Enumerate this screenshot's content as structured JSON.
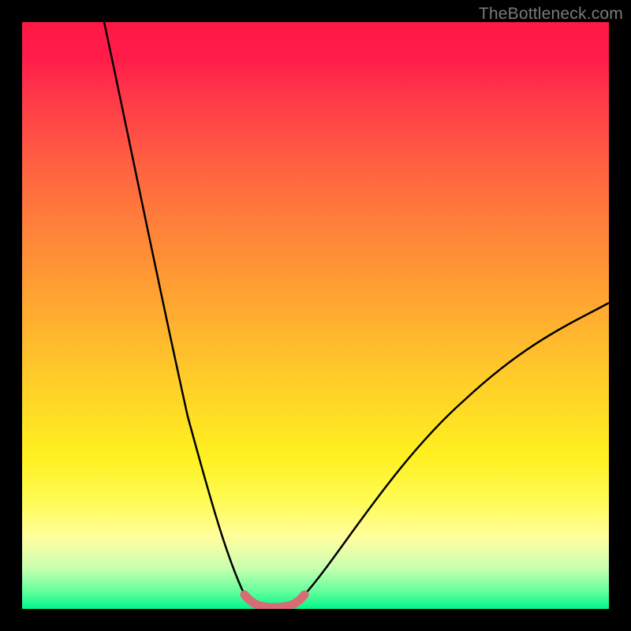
{
  "watermark": "TheBottleneck.com",
  "chart_data": {
    "type": "line",
    "title": "",
    "xlabel": "",
    "ylabel": "",
    "xlim": [
      0,
      100
    ],
    "ylim": [
      0,
      100
    ],
    "grid": false,
    "legend": false,
    "colors": {
      "gradient_top": "#ff1846",
      "gradient_bottom": "#00f78a",
      "curve": "#000000",
      "highlight": "#d86c75"
    },
    "series": [
      {
        "name": "left-branch",
        "x": [
          14,
          16,
          18,
          20,
          22,
          24,
          26,
          28,
          30,
          32,
          34,
          36,
          38
        ],
        "y": [
          100,
          90,
          80,
          70,
          60,
          50,
          40,
          31,
          23,
          15,
          9,
          4,
          1.2
        ]
      },
      {
        "name": "right-branch",
        "x": [
          48,
          50,
          54,
          58,
          62,
          66,
          70,
          74,
          78,
          82,
          86,
          90,
          94,
          98,
          100
        ],
        "y": [
          1.2,
          3,
          6,
          10,
          14,
          18,
          22,
          26,
          30,
          34,
          38,
          42,
          46,
          50,
          52
        ]
      },
      {
        "name": "highlighted-bottom",
        "x": [
          38,
          40,
          42,
          44,
          46,
          48
        ],
        "y": [
          1.2,
          0.6,
          0.4,
          0.4,
          0.6,
          1.2
        ]
      }
    ]
  }
}
